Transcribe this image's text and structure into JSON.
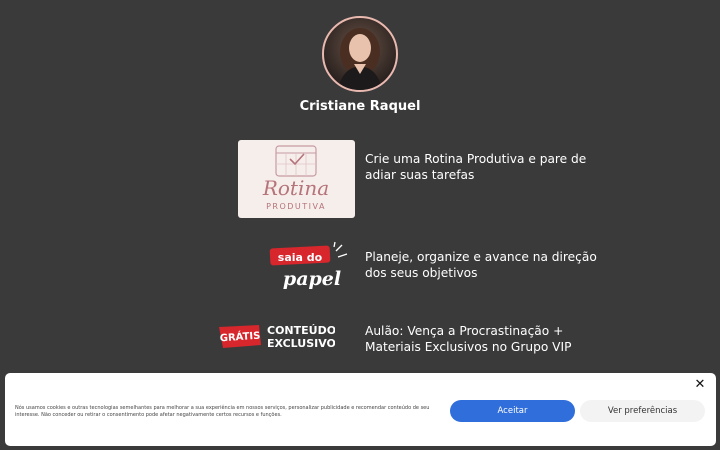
{
  "profile": {
    "name": "Cristiane Raquel"
  },
  "links": [
    {
      "text": "Crie uma Rotina Produtiva e pare de adiar suas tarefas",
      "thumb_word": "Rotina",
      "thumb_sub": "PRODUTIVA"
    },
    {
      "text": "Planeje, organize e avance na direção dos seus objetivos",
      "thumb_top": "saia do",
      "thumb_bottom": "papel"
    },
    {
      "text": "Aulão: Vença a Procrastinação + Materiais Exclusivos no Grupo VIP",
      "thumb_badge": "GRÁTIS",
      "thumb_line1": "CONTEÚDO",
      "thumb_line2": "EXCLUSIVO"
    }
  ],
  "cookie_banner": {
    "text": "Nós usamos cookies e outras tecnologias semelhantes para melhorar a sua experiência em nossos serviços, personalizar publicidade e recomendar conteúdo de seu interesse. Não conceder ou retirar o consentimento pode afetar negativamente certos recursos e funções.",
    "accept_label": "Aceitar",
    "preferences_label": "Ver preferências",
    "close_symbol": "✕"
  },
  "colors": {
    "background": "#3b3a3b",
    "accent_blue": "#2f6edb",
    "brand_red": "#d7262c",
    "rotina_pink": "#b5737a"
  }
}
